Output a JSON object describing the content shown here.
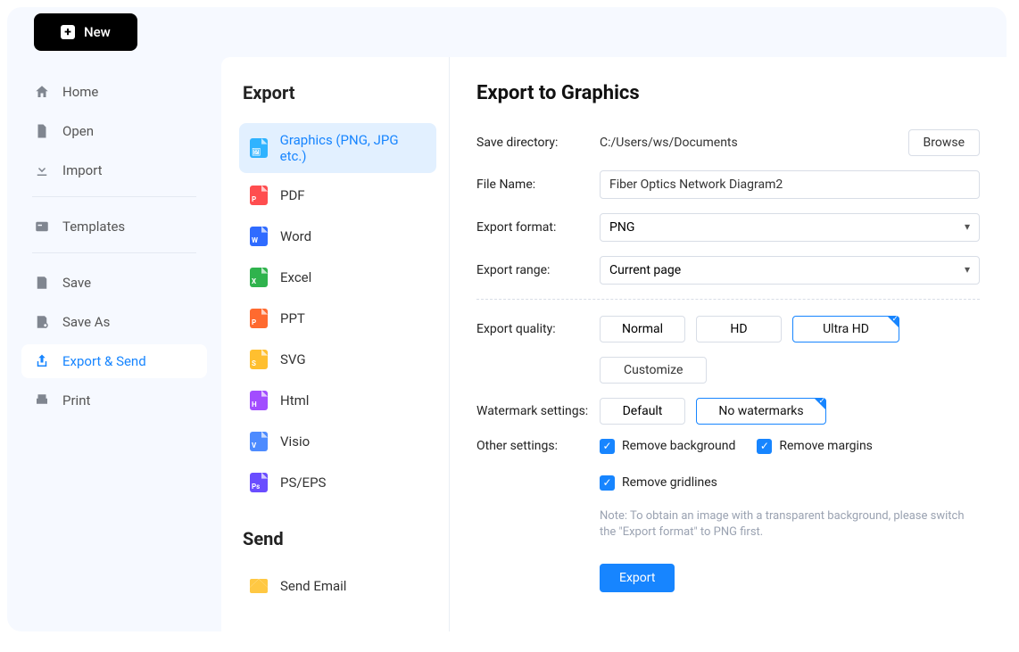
{
  "topbar": {
    "new_label": "New"
  },
  "sidebar": {
    "items": [
      {
        "label": "Home"
      },
      {
        "label": "Open"
      },
      {
        "label": "Import"
      },
      {
        "label": "Templates"
      },
      {
        "label": "Save"
      },
      {
        "label": "Save As"
      },
      {
        "label": "Export & Send"
      },
      {
        "label": "Print"
      }
    ]
  },
  "export": {
    "title": "Export",
    "items": [
      {
        "label": "Graphics (PNG, JPG etc.)",
        "color": "#2fb3ff",
        "letter": ""
      },
      {
        "label": "PDF",
        "color": "#ff4d4f",
        "letter": "P"
      },
      {
        "label": "Word",
        "color": "#2f6bff",
        "letter": "W"
      },
      {
        "label": "Excel",
        "color": "#2fb34d",
        "letter": "X"
      },
      {
        "label": "PPT",
        "color": "#ff6a2f",
        "letter": "P"
      },
      {
        "label": "SVG",
        "color": "#ffbf2f",
        "letter": "S"
      },
      {
        "label": "Html",
        "color": "#a24dff",
        "letter": "H"
      },
      {
        "label": "Visio",
        "color": "#4d8bff",
        "letter": "V"
      },
      {
        "label": "PS/EPS",
        "color": "#6a4dff",
        "letter": "Ps"
      }
    ]
  },
  "send": {
    "title": "Send",
    "email_label": "Send Email"
  },
  "detail": {
    "title": "Export to Graphics",
    "save_dir_label": "Save directory:",
    "save_dir_value": "C:/Users/ws/Documents",
    "browse_label": "Browse",
    "file_name_label": "File Name:",
    "file_name_value": "Fiber Optics Network Diagram2",
    "format_label": "Export format:",
    "format_value": "PNG",
    "range_label": "Export range:",
    "range_value": "Current page",
    "quality_label": "Export quality:",
    "quality_options": {
      "normal": "Normal",
      "hd": "HD",
      "ultra": "Ultra HD"
    },
    "customize_label": "Customize",
    "watermark_label": "Watermark settings:",
    "watermark_options": {
      "default": "Default",
      "none": "No watermarks"
    },
    "other_label": "Other settings:",
    "cb_remove_bg": "Remove background",
    "cb_remove_margins": "Remove margins",
    "cb_remove_gridlines": "Remove gridlines",
    "note": "Note: To obtain an image with a transparent background, please switch the \"Export format\" to PNG first.",
    "export_btn": "Export"
  }
}
